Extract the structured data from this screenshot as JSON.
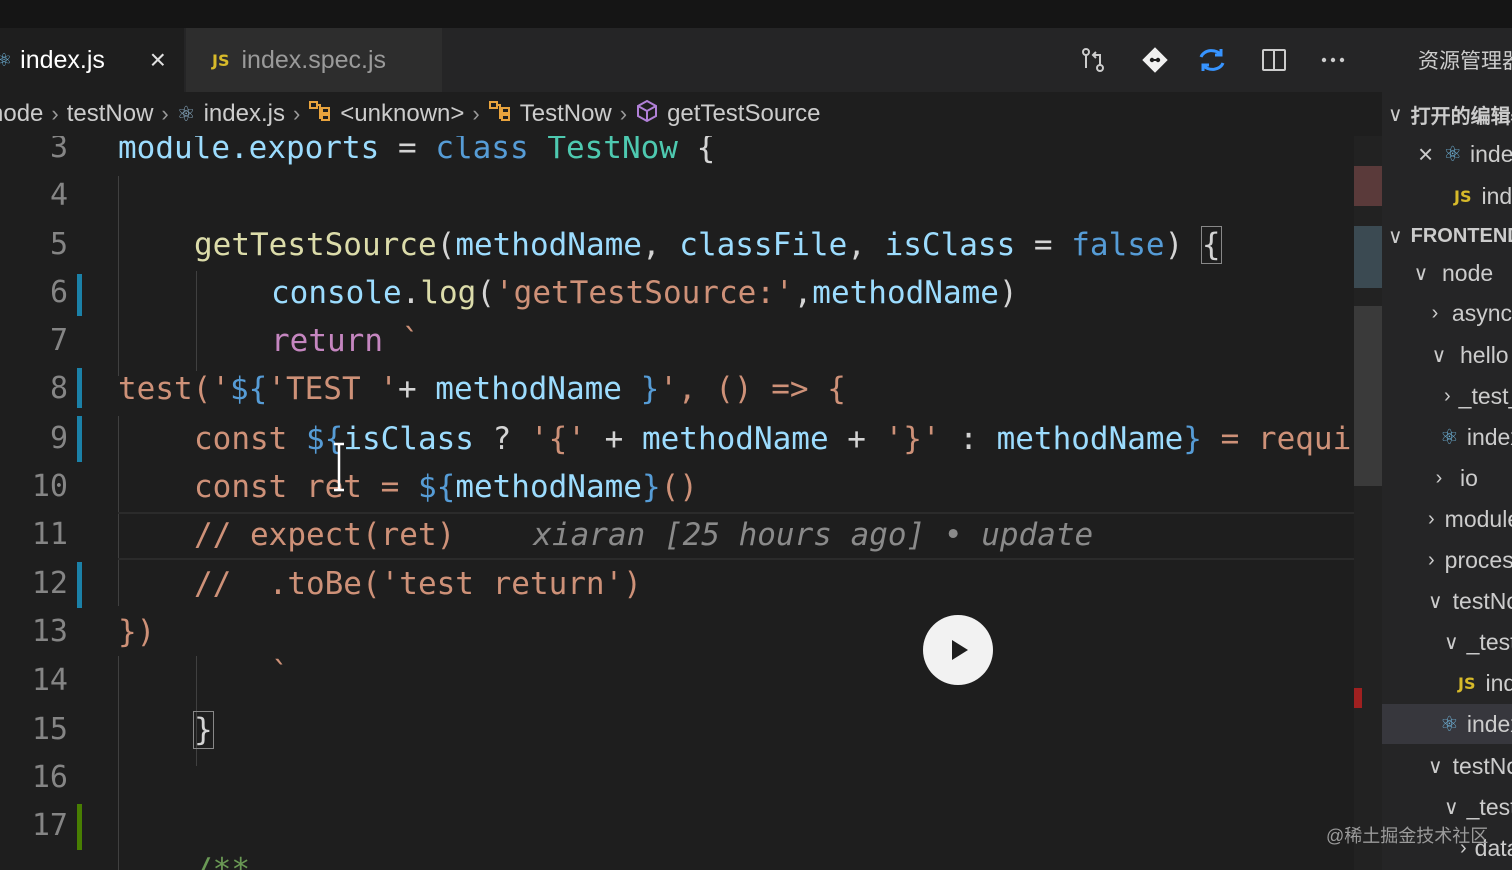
{
  "tabs": [
    {
      "label": "index.js",
      "icon": "react-icon",
      "active": true,
      "close": "×"
    },
    {
      "label": "index.spec.js",
      "icon_text": "JS",
      "active": false
    }
  ],
  "explorer_title": "资源管理器",
  "breadcrumb": {
    "items": [
      {
        "label": "node",
        "icon": ""
      },
      {
        "label": "testNow",
        "icon": ""
      },
      {
        "label": "index.js",
        "icon": "react-icon"
      },
      {
        "label": "<unknown>",
        "icon": "symbol-class-icon"
      },
      {
        "label": "TestNow",
        "icon": "symbol-class-icon"
      },
      {
        "label": "getTestSource",
        "icon": "symbol-method-icon"
      }
    ]
  },
  "line_numbers": [
    "3",
    "4",
    "5",
    "6",
    "7",
    "8",
    "9",
    "10",
    "11",
    "12",
    "13",
    "14",
    "15",
    "16",
    "17"
  ],
  "code": {
    "l3": {
      "a": "module.",
      "b": "exports",
      "c": " = ",
      "d": "class",
      "e": " ",
      "f": "TestNow",
      "g": " {"
    },
    "l5": {
      "a": "getTestSource",
      "b": "(",
      "c": "methodName",
      "d": ", ",
      "e": "classFile",
      "f": ", ",
      "g": "isClass",
      "h": " = ",
      "i": "false",
      "j": ") ",
      "k": "{"
    },
    "l6": {
      "a": "console",
      "b": ".",
      "c": "log",
      "d": "(",
      "e": "'getTestSource:'",
      "f": ",",
      "g": "methodName",
      "h": ")"
    },
    "l7": {
      "a": "return",
      "b": " `"
    },
    "l8": {
      "a": "test('",
      "b": "${",
      "c": "'TEST '",
      "d": "+ ",
      "e": "methodName",
      "f": " }",
      "g": "', () => {"
    },
    "l9": {
      "a": "const ",
      "b": "${",
      "c": "isClass",
      "d": " ? ",
      "e": "'{'",
      "f": " + ",
      "g": "methodName",
      "h": " + ",
      "i": "'}'",
      "j": " : ",
      "k": "methodName",
      "l": "}",
      "m": " = requi"
    },
    "l10": {
      "a": "const ",
      "b": "ret",
      "c": " = ",
      "d": "${",
      "e": "methodName",
      "f": "}",
      "g": "()"
    },
    "l11": {
      "a": "// expect(ret)",
      "blame": "xiaran [25 hours ago] • update"
    },
    "l12": {
      "a": "//  .toBe('test return')"
    },
    "l13": {
      "a": "})"
    },
    "l14": {
      "a": "`"
    },
    "l15": {
      "a": "}"
    },
    "l18": {
      "a": "/**"
    }
  },
  "sidebar": {
    "rows": [
      {
        "label": "打开的编辑器",
        "chev": "∨",
        "bold": true
      },
      {
        "label": "index.js",
        "close": "×",
        "icon": "react-icon"
      },
      {
        "label": "index.spec.js",
        "icon_text": "JS"
      },
      {
        "label": "FRONTEND",
        "chev": "∨",
        "bold": true
      },
      {
        "label": "node",
        "chev": "∨"
      },
      {
        "label": "async",
        "chev": "›"
      },
      {
        "label": "hello",
        "chev": "∨"
      },
      {
        "label": "_test_",
        "chev": "›"
      },
      {
        "label": "index.js",
        "icon": "react-icon"
      },
      {
        "label": "io",
        "chev": "›"
      },
      {
        "label": "module",
        "chev": "›"
      },
      {
        "label": "process",
        "chev": "›"
      },
      {
        "label": "testNow",
        "chev": "∨"
      },
      {
        "label": "_test_",
        "chev": "∨"
      },
      {
        "label": "index.spec.js",
        "icon_text": "JS"
      },
      {
        "label": "index.js",
        "icon": "react-icon",
        "selected": true
      },
      {
        "label": "testNow",
        "chev": "∨"
      },
      {
        "label": "_test_",
        "chev": "∨"
      },
      {
        "label": "data",
        "chev": "›"
      }
    ]
  },
  "watermark": "@稀土掘金技术社区",
  "colors": {
    "accent": "#007acc",
    "keyword": "#569cd6",
    "string": "#ce9178",
    "function": "#dcdcaa",
    "variable": "#9cdcfe",
    "type": "#4ec9b0"
  }
}
